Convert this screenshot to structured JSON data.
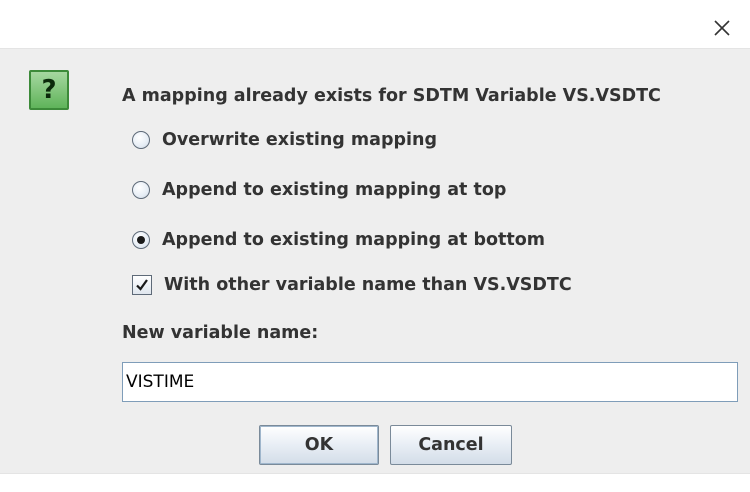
{
  "dialog": {
    "close_icon": "close-icon",
    "question_icon": "question-icon",
    "question_glyph": "?",
    "message": "A mapping already exists for SDTM Variable VS.VSDTC",
    "options": [
      {
        "label": "Overwrite existing mapping",
        "selected": false
      },
      {
        "label": "Append to existing mapping at top",
        "selected": false
      },
      {
        "label": "Append to existing mapping at bottom",
        "selected": true
      }
    ],
    "checkbox": {
      "label": "With other variable name than VS.VSDTC",
      "checked": true
    },
    "field_label": "New variable name:",
    "field_value": "VISTIME",
    "ok_label": "OK",
    "cancel_label": "Cancel"
  },
  "colors": {
    "panel_bg": "#eeeeee",
    "icon_green": "#5fb45a",
    "text": "#333333",
    "input_border": "#7f9db9"
  }
}
